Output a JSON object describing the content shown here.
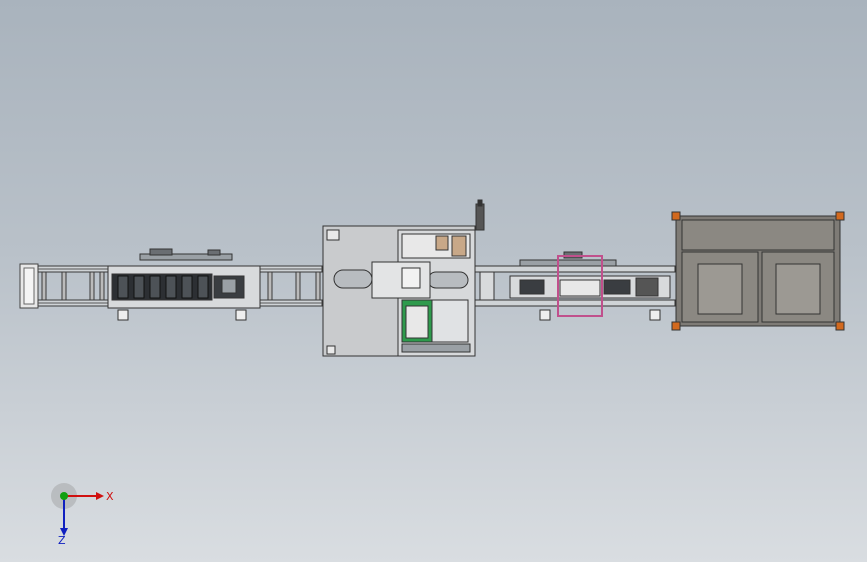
{
  "viewport": {
    "title": "",
    "background_top": "#a9b3bd",
    "background_bottom": "#d9dde1"
  },
  "model": {
    "units": [
      {
        "name": "left-conveyor-frame"
      },
      {
        "name": "left-rail-module"
      },
      {
        "name": "center-machine"
      },
      {
        "name": "right-rail-module"
      },
      {
        "name": "right-cabinet"
      }
    ],
    "highlight_color": "#c0508c"
  },
  "triad": {
    "x_label": "X",
    "z_label": "Z",
    "x_color": "#d01010",
    "y_color": "#10a010",
    "z_color": "#1020c0"
  }
}
